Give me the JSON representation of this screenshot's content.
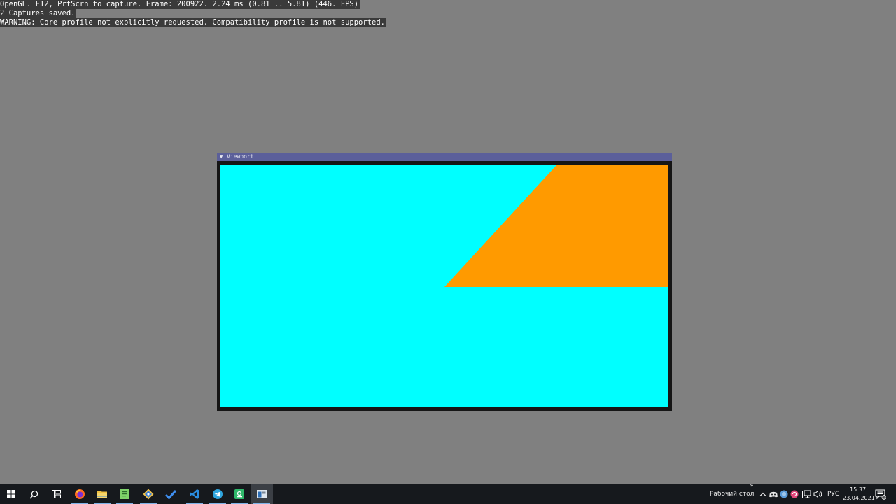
{
  "overlay": {
    "lines": [
      "OpenGL. F12, PrtScrn to capture. Frame: 200922. 2.24 ms (0.81 .. 5.81) (446. FPS)",
      "2 Captures saved.",
      "WARNING: Core profile not explicitly requested. Compatibility profile is not supported."
    ]
  },
  "viewport": {
    "title": "Viewport",
    "arrow": "▼",
    "colors": {
      "background": "#00ffff",
      "shape": "#ff9a00",
      "frame": "#151515",
      "titlebar": "#5b5f9a"
    }
  },
  "taskbar": {
    "apps": [
      {
        "name": "windows-start",
        "icon": "windows-logo-icon"
      },
      {
        "name": "search",
        "icon": "search-icon"
      },
      {
        "name": "task-view",
        "icon": "task-view-icon"
      },
      {
        "name": "firefox",
        "icon": "firefox-icon"
      },
      {
        "name": "file-explorer",
        "icon": "folder-icon"
      },
      {
        "name": "notepad",
        "icon": "notepad-icon"
      },
      {
        "name": "git",
        "icon": "git-icon"
      },
      {
        "name": "todo",
        "icon": "checkmark-icon"
      },
      {
        "name": "vscode",
        "icon": "vscode-icon"
      },
      {
        "name": "telegram",
        "icon": "telegram-icon"
      },
      {
        "name": "app-green",
        "icon": "green-app-icon"
      },
      {
        "name": "running-app",
        "icon": "window-app-icon"
      }
    ],
    "desktop_label": "Рабочий стол",
    "chevrons": "»",
    "language": "РУС",
    "time": "15:37",
    "date": "23.04.2021",
    "notification_count": "1"
  }
}
